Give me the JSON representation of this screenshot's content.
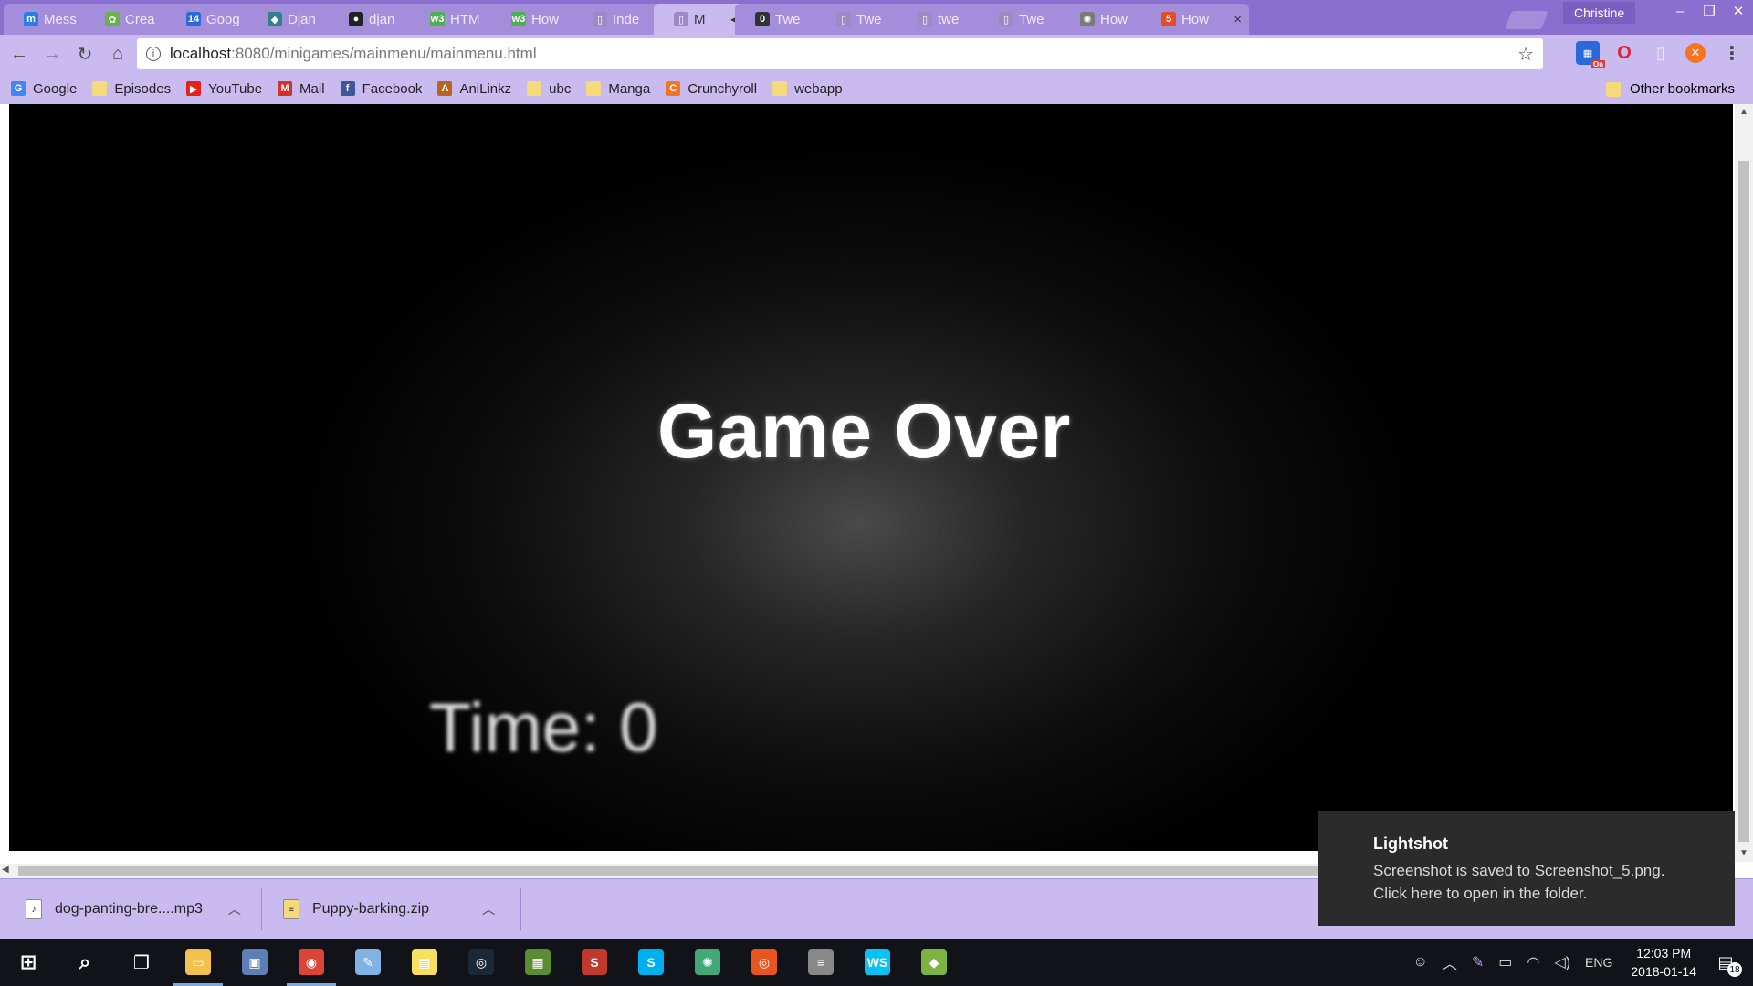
{
  "browser": {
    "profile_name": "Christine",
    "url_host": "localhost",
    "url_path": ":8080/minigames/mainmenu/mainmenu.html",
    "tabs": [
      {
        "title": "Mess",
        "icon": "messenger-icon",
        "color": "#2a7de1",
        "glyph": "m"
      },
      {
        "title": "Crea",
        "icon": "leaf-icon",
        "color": "#6ab04c",
        "glyph": "✿"
      },
      {
        "title": "Goog",
        "icon": "calendar-icon",
        "color": "#2a6ad8",
        "glyph": "14"
      },
      {
        "title": "Djan",
        "icon": "django-pony-icon",
        "color": "#2f7f8f",
        "glyph": "◆"
      },
      {
        "title": "djan",
        "icon": "github-icon",
        "color": "#222222",
        "glyph": "●"
      },
      {
        "title": "HTM",
        "icon": "w3schools-icon",
        "color": "#4caf50",
        "glyph": "w3"
      },
      {
        "title": "How",
        "icon": "w3schools-icon",
        "color": "#4caf50",
        "glyph": "w3"
      },
      {
        "title": "Inde",
        "icon": "page-icon",
        "color": "#9b8ac4",
        "glyph": "▯"
      },
      {
        "title": "M",
        "icon": "page-icon",
        "color": "#9b8ac4",
        "glyph": "▯",
        "active": true
      },
      {
        "title": "Twe",
        "icon": "zero-icon",
        "color": "#333333",
        "glyph": "0"
      },
      {
        "title": "Twe",
        "icon": "page-icon",
        "color": "#9b8ac4",
        "glyph": "▯"
      },
      {
        "title": "twe",
        "icon": "page-icon",
        "color": "#9b8ac4",
        "glyph": "▯"
      },
      {
        "title": "Twe",
        "icon": "page-icon",
        "color": "#9b8ac4",
        "glyph": "▯"
      },
      {
        "title": "How",
        "icon": "atom-icon",
        "color": "#7a7a7a",
        "glyph": "✺"
      },
      {
        "title": "How",
        "icon": "html5-icon",
        "color": "#e44d26",
        "glyph": "5"
      }
    ],
    "bookmarks": [
      {
        "label": "Google",
        "icon": "google-icon",
        "color": "#4285f4",
        "glyph": "G"
      },
      {
        "label": "Episodes",
        "icon": "folder-icon",
        "color": "#f5d97a",
        "glyph": ""
      },
      {
        "label": "YouTube",
        "icon": "youtube-icon",
        "color": "#e62117",
        "glyph": "▶"
      },
      {
        "label": "Mail",
        "icon": "gmail-icon",
        "color": "#d93025",
        "glyph": "M"
      },
      {
        "label": "Facebook",
        "icon": "facebook-icon",
        "color": "#3b5998",
        "glyph": "f"
      },
      {
        "label": "AniLinkz",
        "icon": "anilinkz-icon",
        "color": "#b5651d",
        "glyph": "A"
      },
      {
        "label": "ubc",
        "icon": "folder-icon",
        "color": "#f5d97a",
        "glyph": ""
      },
      {
        "label": "Manga",
        "icon": "folder-icon",
        "color": "#f5d97a",
        "glyph": ""
      },
      {
        "label": "Crunchyroll",
        "icon": "crunchyroll-icon",
        "color": "#f47521",
        "glyph": "C"
      },
      {
        "label": "webapp",
        "icon": "folder-icon",
        "color": "#f5d97a",
        "glyph": ""
      }
    ],
    "other_bookmarks": "Other bookmarks",
    "extensions_badge": "On"
  },
  "game": {
    "title": "Game Over",
    "timer": "Time: 0"
  },
  "downloads": [
    {
      "name": "dog-panting-bre....mp3",
      "icon": "audio-file-icon"
    },
    {
      "name": "Puppy-barking.zip",
      "icon": "zip-file-icon"
    }
  ],
  "toast": {
    "app": "Lightshot",
    "line1": "Screenshot is saved to Screenshot_5.png.",
    "line2": "Click here to open in the folder."
  },
  "taskbar": {
    "apps": [
      {
        "name": "file-explorer-icon",
        "color": "#f2c14e",
        "glyph": "▭",
        "running": true
      },
      {
        "name": "photos-icon",
        "color": "#5d7fb5",
        "glyph": "▣"
      },
      {
        "name": "chrome-icon",
        "color": "#db4437",
        "glyph": "◉",
        "running": true
      },
      {
        "name": "paint-icon",
        "color": "#7fb2e5",
        "glyph": "✎"
      },
      {
        "name": "sticky-notes-icon",
        "color": "#f6e05e",
        "glyph": "▤"
      },
      {
        "name": "steam-icon",
        "color": "#1b2838",
        "glyph": "◎"
      },
      {
        "name": "minecraft-icon",
        "color": "#5b8c32",
        "glyph": "▦"
      },
      {
        "name": "slides-icon",
        "color": "#c0392b",
        "glyph": "S"
      },
      {
        "name": "skype-icon",
        "color": "#00aff0",
        "glyph": "S"
      },
      {
        "name": "atom-icon",
        "color": "#40a977",
        "glyph": "✺"
      },
      {
        "name": "ubuntu-icon",
        "color": "#e95420",
        "glyph": "◎"
      },
      {
        "name": "database-icon",
        "color": "#888888",
        "glyph": "≡"
      },
      {
        "name": "webstorm-icon",
        "color": "#07c3f2",
        "glyph": "WS"
      },
      {
        "name": "git-icon",
        "color": "#7cb342",
        "glyph": "◆"
      }
    ],
    "language": "ENG",
    "time": "12:03 PM",
    "date": "2018-01-14",
    "notifications": "18"
  }
}
